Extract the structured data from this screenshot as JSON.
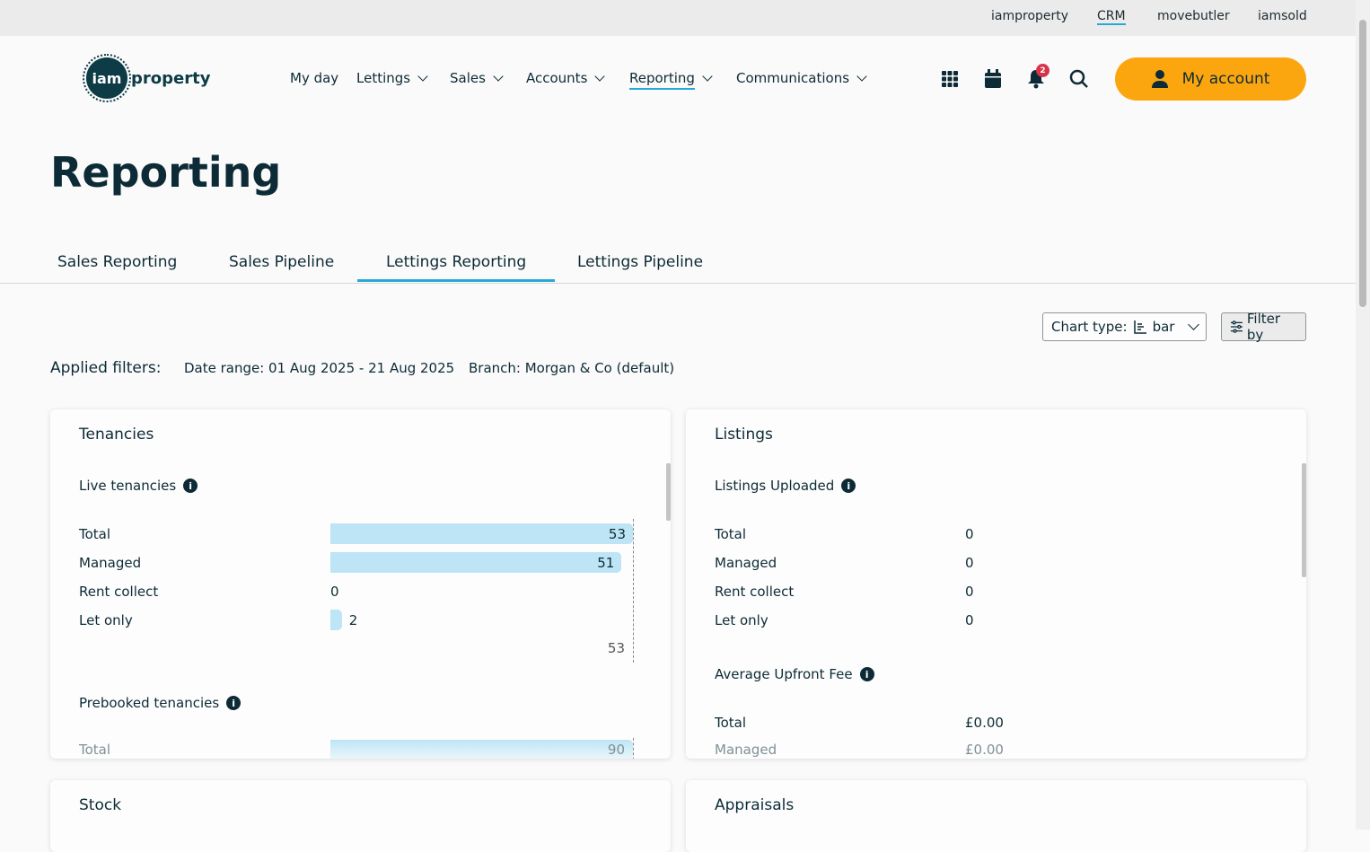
{
  "top_links": [
    "iamproperty",
    "CRM",
    "movebutler",
    "iamsold"
  ],
  "top_active": "CRM",
  "logo": {
    "circle": "iam",
    "word": "property"
  },
  "nav": [
    "My day",
    "Lettings",
    "Sales",
    "Accounts",
    "Reporting",
    "Communications"
  ],
  "nav_active": "Reporting",
  "notifications_count": "2",
  "account_label": "My account",
  "page_title": "Reporting",
  "tabs": [
    "Sales Reporting",
    "Sales Pipeline",
    "Lettings Reporting",
    "Lettings Pipeline"
  ],
  "active_tab": "Lettings Reporting",
  "chart_type": {
    "label": "Chart type:",
    "value": "bar"
  },
  "filter_label": "Filter by",
  "applied": {
    "label": "Applied filters:",
    "date": "Date range: 01 Aug 2025 - 21 Aug 2025",
    "branch": "Branch: Morgan & Co (default)"
  },
  "colors": {
    "accent": "#27a9d6",
    "button": "#fca60f",
    "bar": "#bde5f5",
    "badge": "#d8334a"
  },
  "tenancies": {
    "title": "Tenancies",
    "live": {
      "title": "Live tenancies",
      "rows": [
        {
          "label": "Total",
          "value": 53
        },
        {
          "label": "Managed",
          "value": 51
        },
        {
          "label": "Rent collect",
          "value": 0
        },
        {
          "label": "Let only",
          "value": 2
        }
      ],
      "axis_max": "53"
    },
    "prebooked": {
      "title": "Prebooked tenancies",
      "rows": [
        {
          "label": "Total",
          "value": 90
        }
      ]
    }
  },
  "listings": {
    "title": "Listings",
    "uploaded": {
      "title": "Listings Uploaded",
      "rows": [
        {
          "label": "Total",
          "value": "0"
        },
        {
          "label": "Managed",
          "value": "0"
        },
        {
          "label": "Rent collect",
          "value": "0"
        },
        {
          "label": "Let only",
          "value": "0"
        }
      ]
    },
    "fee": {
      "title": "Average Upfront Fee",
      "rows": [
        {
          "label": "Total",
          "value": "£0.00"
        },
        {
          "label": "Managed",
          "value": "£0.00"
        }
      ]
    }
  },
  "stock_title": "Stock",
  "appraisals_title": "Appraisals"
}
